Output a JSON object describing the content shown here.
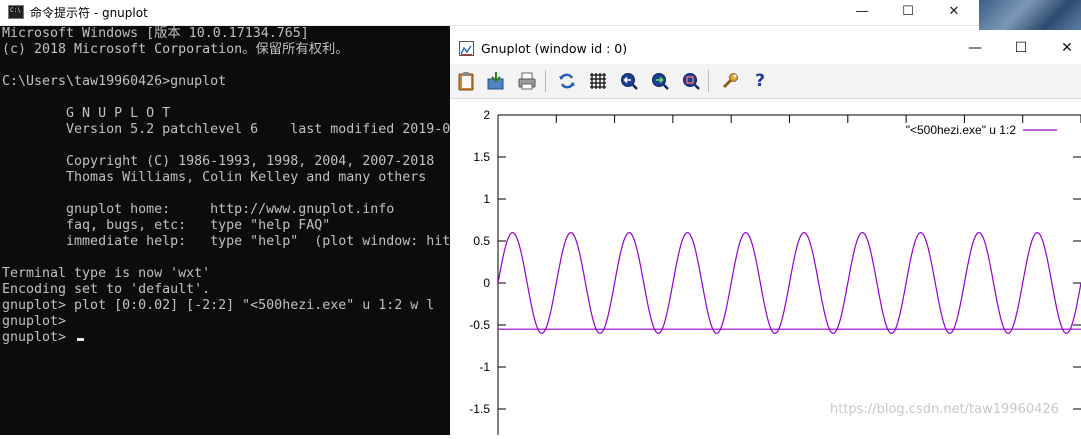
{
  "cmd": {
    "title": "命令提示符 - gnuplot",
    "controls": {
      "minimize": "—",
      "maximize": "☐",
      "close": "✕"
    },
    "lines": [
      "Microsoft Windows [版本 10.0.17134.765]",
      "(c) 2018 Microsoft Corporation。保留所有权利。",
      "",
      "C:\\Users\\taw19960426>gnuplot",
      "",
      "\tG N U P L O T",
      "\tVersion 5.2 patchlevel 6    last modified 2019-0",
      "",
      "\tCopyright (C) 1986-1993, 1998, 2004, 2007-2018",
      "\tThomas Williams, Colin Kelley and many others",
      "",
      "\tgnuplot home:     http://www.gnuplot.info",
      "\tfaq, bugs, etc:   type \"help FAQ\"",
      "\timmediate help:   type \"help\"  (plot window: hit",
      "",
      "Terminal type is now 'wxt'",
      "Encoding set to 'default'.",
      "gnuplot> plot [0:0.02] [-2:2] \"<500hezi.exe\" u 1:2 w l",
      "gnuplot>",
      "gnuplot> "
    ]
  },
  "gnuplot": {
    "title": "Gnuplot (window id : 0)",
    "controls": {
      "minimize": "—",
      "maximize": "☐",
      "close": "✕"
    },
    "toolbar": [
      {
        "name": "copy-clipboard-icon"
      },
      {
        "name": "export-icon"
      },
      {
        "name": "print-icon"
      },
      {
        "name": "replot-icon"
      },
      {
        "name": "grid-icon"
      },
      {
        "name": "zoom-previous-icon"
      },
      {
        "name": "zoom-next-icon"
      },
      {
        "name": "autoscale-icon"
      },
      {
        "name": "options-icon"
      },
      {
        "name": "help-icon",
        "glyph": "?"
      }
    ],
    "watermark": "https://blog.csdn.net/taw19960426"
  },
  "chart_data": {
    "type": "line",
    "xlim": [
      0,
      0.02
    ],
    "ylim": [
      -2,
      2
    ],
    "yticks": [
      -1.5,
      -1,
      -0.5,
      0,
      0.5,
      1,
      1.5,
      2
    ],
    "series": [
      {
        "name": "\"<500hezi.exe\" u 1:2",
        "color": "#9400d3",
        "frequency_hz": 500,
        "peak": 0.6,
        "trough": -0.6,
        "dc_line": -0.55
      }
    ],
    "legend_position": "top-right",
    "grid": false
  }
}
